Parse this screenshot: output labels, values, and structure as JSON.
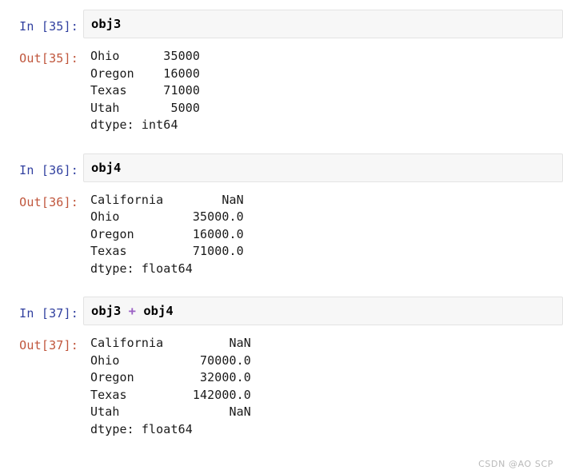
{
  "notebook": {
    "cells": [
      {
        "prompt_in": "In [35]:",
        "code": "obj3",
        "prompt_out": "Out[35]:",
        "output": "Ohio      35000\nOregon    16000\nTexas     71000\nUtah       5000\ndtype: int64"
      },
      {
        "prompt_in": "In [36]:",
        "code": "obj4",
        "prompt_out": "Out[36]:",
        "output": "California        NaN\nOhio          35000.0\nOregon        16000.0\nTexas         71000.0\ndtype: float64"
      },
      {
        "prompt_in": "In [37]:",
        "code_left": "obj3 ",
        "code_op": "+",
        "code_right": " obj4",
        "prompt_out": "Out[37]:",
        "output": "California         NaN\nOhio           70000.0\nOregon         32000.0\nTexas         142000.0\nUtah               NaN\ndtype: float64"
      }
    ]
  },
  "watermark": {
    "text": "CSDN @AO SCP"
  },
  "colors": {
    "prompt_in": "#303f9f",
    "prompt_out": "#c0563c",
    "operator": "#9a5fc4",
    "input_background": "#f7f7f7",
    "input_border": "#e3e3e3",
    "page_background": "#ffffff",
    "output_text": "#1a1a1a",
    "watermark": "#b9b9b9"
  }
}
